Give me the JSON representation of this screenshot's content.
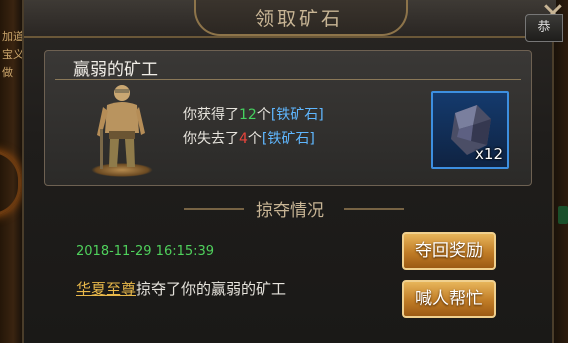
{
  "background": {
    "left_text": [
      "加道",
      "宝义",
      "做"
    ]
  },
  "window": {
    "title": "领取矿石",
    "close_glyph": "✕",
    "corner_tag": "恭"
  },
  "card": {
    "title": "赢弱的矿工",
    "gain_prefix": "你获得了",
    "gain_count": "12",
    "gain_unit": "个",
    "gain_item": "[铁矿石]",
    "loss_prefix": "你失去了",
    "loss_count": "4",
    "loss_unit": "个",
    "loss_item": "[铁矿石]",
    "item_icon": "iron-ore-icon",
    "item_quantity": "x12"
  },
  "plunder": {
    "section_title": "掠夺情况",
    "timestamp": "2018-11-29 16:15:39",
    "attacker": "华夏至尊",
    "action_text": "掠夺了你的",
    "target": "赢弱的矿工",
    "reclaim_button": "夺回奖励",
    "help_button": "喊人帮忙"
  },
  "colors": {
    "gain": "#45d05f",
    "loss": "#e8443b",
    "item_link": "#5fb7ff",
    "attacker_link": "#e8b84a",
    "button": "#c07c26"
  }
}
